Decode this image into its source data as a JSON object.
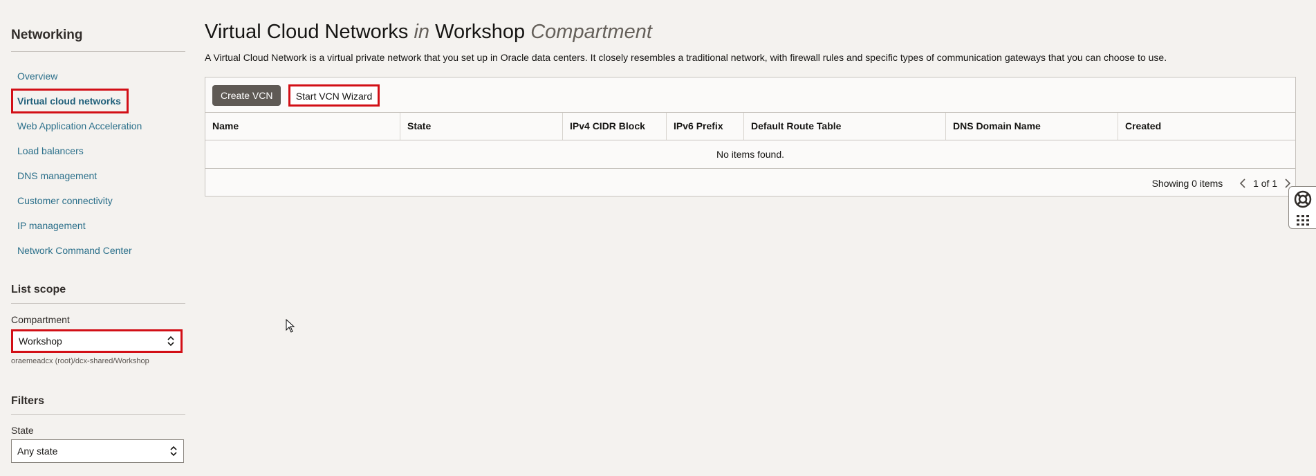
{
  "sidebar": {
    "heading": "Networking",
    "items": [
      {
        "label": "Overview",
        "active": false
      },
      {
        "label": "Virtual cloud networks",
        "active": true
      },
      {
        "label": "Web Application Acceleration",
        "active": false
      },
      {
        "label": "Load balancers",
        "active": false
      },
      {
        "label": "DNS management",
        "active": false
      },
      {
        "label": "Customer connectivity",
        "active": false
      },
      {
        "label": "IP management",
        "active": false
      },
      {
        "label": "Network Command Center",
        "active": false
      }
    ],
    "list_scope": {
      "heading": "List scope",
      "compartment_label": "Compartment",
      "compartment_value": "Workshop",
      "compartment_path": "oraemeadcx (root)/dcx-shared/Workshop"
    },
    "filters": {
      "heading": "Filters",
      "state_label": "State",
      "state_value": "Any state"
    }
  },
  "main": {
    "title": {
      "part1": "Virtual Cloud Networks",
      "part2": "in",
      "part3": "Workshop",
      "part4": "Compartment"
    },
    "description": "A Virtual Cloud Network is a virtual private network that you set up in Oracle data centers. It closely resembles a traditional network, with firewall rules and specific types of communication gateways that you can choose to use.",
    "buttons": {
      "create": "Create VCN",
      "wizard": "Start VCN Wizard"
    },
    "table": {
      "columns": [
        "Name",
        "State",
        "IPv4 CIDR Block",
        "IPv6 Prefix",
        "Default Route Table",
        "DNS Domain Name",
        "Created"
      ],
      "empty_message": "No items found."
    },
    "footer": {
      "showing": "Showing 0 items",
      "page": "1 of 1"
    }
  },
  "icons": {
    "select_chevron": "chevron-updown-icon",
    "pager_prev": "chevron-left-icon",
    "pager_next": "chevron-right-icon",
    "help": "lifebuoy-icon",
    "apps": "grid-icon",
    "cursor": "mouse-pointer-icon"
  },
  "colors": {
    "highlight": "#d20f16",
    "link": "#2a6f8a",
    "primary_button": "#5f5a55"
  }
}
